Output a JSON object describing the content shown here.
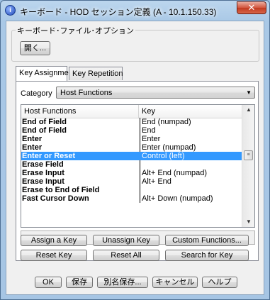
{
  "window": {
    "title": "キーボード - HOD セッション定義 (A - 10.1.150.33)",
    "close_glyph": "✕",
    "app_icon_letter": "i"
  },
  "file_options": {
    "legend": "キーボード･ファイル･オプション",
    "open_label": "開く..."
  },
  "tabs": [
    {
      "label": "Key Assignment",
      "active": true
    },
    {
      "label": "Key Repetition",
      "active": false
    }
  ],
  "category": {
    "label": "Category",
    "selected": "Host Functions",
    "arrow_glyph": "▼"
  },
  "table": {
    "columns": [
      "Host Functions",
      "Key"
    ],
    "rows": [
      {
        "function": "End of Field",
        "key": "End (numpad)",
        "selected": false
      },
      {
        "function": "End of Field",
        "key": "End",
        "selected": false
      },
      {
        "function": "Enter",
        "key": "Enter",
        "selected": false
      },
      {
        "function": "Enter",
        "key": "Enter (numpad)",
        "selected": false
      },
      {
        "function": "Enter or Reset",
        "key": "Control (left)",
        "selected": true
      },
      {
        "function": "Erase Field",
        "key": "",
        "selected": false
      },
      {
        "function": "Erase Input",
        "key": "Alt+ End (numpad)",
        "selected": false
      },
      {
        "function": "Erase Input",
        "key": "Alt+ End",
        "selected": false
      },
      {
        "function": "Erase to End of Field",
        "key": "",
        "selected": false
      },
      {
        "function": "Fast Cursor Down",
        "key": "Alt+ Down (numpad)",
        "selected": false
      }
    ],
    "scroll_up_glyph": "▲",
    "scroll_down_glyph": "▼",
    "scroll_thumb_glyph": "≡"
  },
  "status_text": "",
  "action_buttons": {
    "assign": "Assign a Key",
    "unassign": "Unassign Key",
    "custom": "Custom Functions...",
    "reset_key": "Reset Key",
    "reset_all": "Reset All",
    "search": "Search for Key"
  },
  "dialog_buttons": {
    "ok": "OK",
    "save": "保存",
    "save_as": "別名保存...",
    "cancel": "キャンセル",
    "help": "ヘルプ"
  },
  "colors": {
    "selection": "#3399ff",
    "title_bar": "#a9c8e6",
    "close_button": "#c13a20"
  }
}
